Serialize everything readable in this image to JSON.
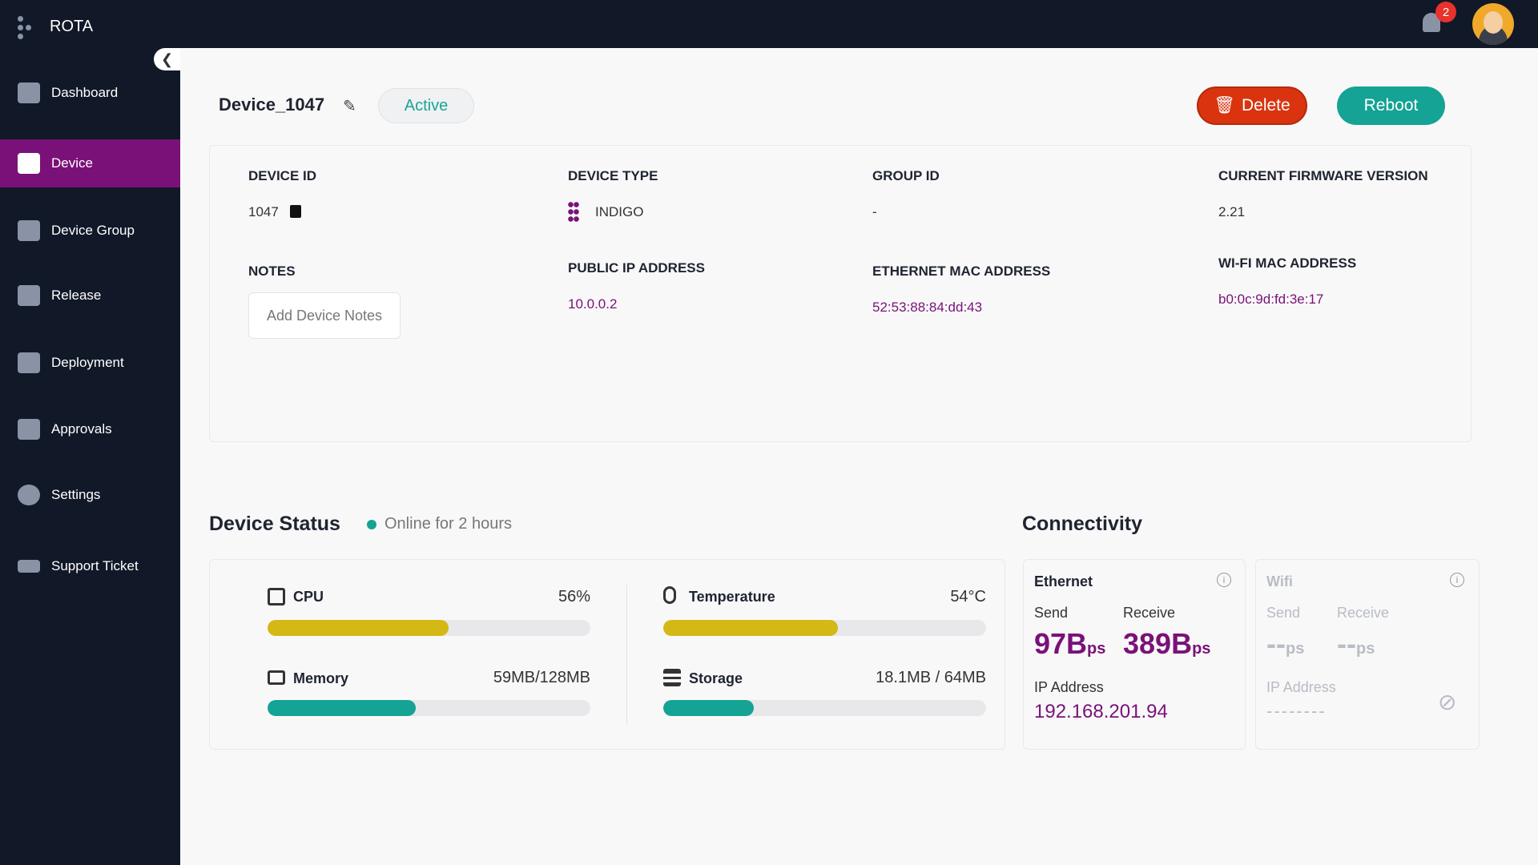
{
  "app": {
    "name": "ROTA",
    "notification_count": "2"
  },
  "sidebar": {
    "items": [
      {
        "label": "Dashboard",
        "icon": "dashboard-icon"
      },
      {
        "label": "Device",
        "icon": "device-icon",
        "active": true
      },
      {
        "label": "Device Group",
        "icon": "device-group-icon"
      },
      {
        "label": "Release",
        "icon": "package-icon"
      },
      {
        "label": "Deployment",
        "icon": "rocket-icon"
      },
      {
        "label": "Approvals",
        "icon": "approvals-icon"
      },
      {
        "label": "Settings",
        "icon": "gear-icon"
      },
      {
        "label": "Support Ticket",
        "icon": "ticket-icon"
      }
    ]
  },
  "header": {
    "title": "Device_1047",
    "status": "Active",
    "delete_label": "Delete",
    "reboot_label": "Reboot"
  },
  "details": {
    "device_id_label": "DEVICE ID",
    "device_id": "1047",
    "device_type_label": "DEVICE TYPE",
    "device_type": "INDIGO",
    "group_id_label": "GROUP ID",
    "group_id": "-",
    "firmware_label": "CURRENT FIRMWARE VERSION",
    "firmware": "2.21",
    "notes_label": "NOTES",
    "notes_placeholder": "Add Device Notes",
    "public_ip_label": "PUBLIC IP ADDRESS",
    "public_ip": "10.0.0.2",
    "eth_mac_label": "ETHERNET MAC ADDRESS",
    "eth_mac": "52:53:88:84:dd:43",
    "wifi_mac_label": "WI-FI MAC ADDRESS",
    "wifi_mac": "b0:0c:9d:fd:3e:17"
  },
  "status": {
    "title": "Device Status",
    "online": "Online for 2 hours",
    "metrics": [
      {
        "label": "CPU",
        "value": "56%",
        "percent": 56,
        "color": "#d4b816"
      },
      {
        "label": "Temperature",
        "value": "54°C",
        "percent": 54,
        "color": "#d4b816"
      },
      {
        "label": "Memory",
        "value": "59MB/128MB",
        "percent": 46,
        "color": "#14a394"
      },
      {
        "label": "Storage",
        "value": "18.1MB / 64MB",
        "percent": 28,
        "color": "#14a394"
      }
    ]
  },
  "connectivity": {
    "title": "Connectivity",
    "ethernet": {
      "title": "Ethernet",
      "send_label": "Send",
      "receive_label": "Receive",
      "send": "97B",
      "receive": "389B",
      "unit": "ps",
      "ip_label": "IP Address",
      "ip": "192.168.201.94"
    },
    "wifi": {
      "title": "Wifi",
      "send_label": "Send",
      "receive_label": "Receive",
      "send": "--",
      "receive": "--",
      "unit": "ps",
      "ip_label": "IP Address",
      "ip": "--------"
    }
  }
}
